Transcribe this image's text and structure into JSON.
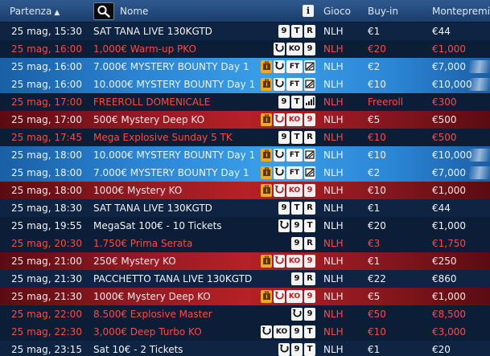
{
  "header": {
    "col_start": "Partenza",
    "sort_indicator": "▲",
    "col_name": "Nome",
    "info": "i",
    "col_game": "Gioco",
    "col_buyin": "Buy-in",
    "col_prize": "Montepremi"
  },
  "colors": {
    "header": "#2f5a8f",
    "row": "#0f2342",
    "red_text": "#ff4a3d",
    "bounty_row": "#2c86d6",
    "mystery_row": "#b52126",
    "badge_gold": "#f0a81c"
  },
  "rows": [
    {
      "time": "25 mag, 15:30",
      "name": "SAT TANA LIVE 130KGTD",
      "game": "NLH",
      "buyin": "€1",
      "prize": "€44",
      "style": "normal",
      "icons": [
        "9",
        "T",
        "R"
      ]
    },
    {
      "time": "25 mag, 16:00",
      "name": "1,000€ Warm-up PKO",
      "game": "NLH",
      "buyin": "€20",
      "prize": "€1,000",
      "style": "red-text",
      "icons": [
        "rebuy-arrow-icon",
        "KO",
        "9"
      ]
    },
    {
      "time": "25 mag, 16:00",
      "name": "7.000€ MYSTERY BOUNTY Day 1",
      "game": "NLH",
      "buyin": "€2",
      "prize": "€7,000",
      "style": "bounty",
      "icons": [
        "mystery-box-icon",
        "rebuy-arrow-icon",
        "FT",
        "multi-day-icon"
      ]
    },
    {
      "time": "25 mag, 16:00",
      "name": "10.000€ MYSTERY BOUNTY Day 1",
      "game": "NLH",
      "buyin": "€10",
      "prize": "€10,000",
      "style": "bounty",
      "icons": [
        "mystery-box-icon",
        "rebuy-arrow-icon",
        "FT",
        "multi-day-icon"
      ]
    },
    {
      "time": "25 mag, 17:00",
      "name": "FREEROLL DOMENICALE",
      "game": "NLH",
      "buyin": "Freeroll",
      "prize": "€300",
      "style": "red-text",
      "icons": [
        "9",
        "T",
        "signal-bars-icon"
      ]
    },
    {
      "time": "25 mag, 17:00",
      "name": "500€ Mystery Deep KO",
      "game": "NLH",
      "buyin": "€5",
      "prize": "€500",
      "style": "mystery",
      "icons": [
        "mystery-box-icon",
        "rebuy-arrow-icon",
        "KO",
        "9"
      ]
    },
    {
      "time": "25 mag, 17:45",
      "name": "Mega Explosive Sunday 5 TK",
      "game": "NLH",
      "buyin": "€10",
      "prize": "€500",
      "style": "red-text",
      "icons": [
        "9",
        "T",
        "R"
      ]
    },
    {
      "time": "25 mag, 18:00",
      "name": "10.000€ MYSTERY BOUNTY Day 1",
      "game": "NLH",
      "buyin": "€10",
      "prize": "€10,000",
      "style": "bounty",
      "icons": [
        "mystery-box-icon",
        "rebuy-arrow-icon",
        "FT",
        "multi-day-icon"
      ]
    },
    {
      "time": "25 mag, 18:00",
      "name": "7.000€ MYSTERY BOUNTY Day 1",
      "game": "NLH",
      "buyin": "€2",
      "prize": "€7,000",
      "style": "bounty",
      "icons": [
        "mystery-box-icon",
        "rebuy-arrow-icon",
        "FT",
        "multi-day-icon"
      ]
    },
    {
      "time": "25 mag, 18:00",
      "name": "1000€ Mystery KO",
      "game": "NLH",
      "buyin": "€10",
      "prize": "€1,000",
      "style": "mystery",
      "icons": [
        "mystery-box-icon",
        "rebuy-arrow-icon",
        "KO",
        "9"
      ]
    },
    {
      "time": "25 mag, 18:30",
      "name": "SAT TANA LIVE 130KGTD",
      "game": "NLH",
      "buyin": "€1",
      "prize": "€44",
      "style": "normal",
      "icons": [
        "9",
        "T",
        "R"
      ]
    },
    {
      "time": "25 mag, 19:55",
      "name": "MegaSat 100€ - 10 Tickets",
      "game": "NLH",
      "buyin": "€20",
      "prize": "€1,000",
      "style": "normal",
      "icons": [
        "rebuy-arrow-icon",
        "9",
        "T"
      ]
    },
    {
      "time": "25 mag, 20:30",
      "name": "1.750€ Prima Serata",
      "game": "NLH",
      "buyin": "€3",
      "prize": "€1,750",
      "style": "red-text",
      "icons": [
        "9",
        "R"
      ]
    },
    {
      "time": "25 mag, 21:00",
      "name": "250€ Mystery KO",
      "game": "NLH",
      "buyin": "€1",
      "prize": "€250",
      "style": "mystery",
      "icons": [
        "mystery-box-icon",
        "rebuy-arrow-icon",
        "KO",
        "9"
      ]
    },
    {
      "time": "25 mag, 21:30",
      "name": "PACCHETTO TANA LIVE 130KGTD",
      "game": "NLH",
      "buyin": "€22",
      "prize": "€860",
      "style": "normal",
      "icons": [
        "9",
        "R"
      ]
    },
    {
      "time": "25 mag, 21:30",
      "name": "1000€ Mystery Deep KO",
      "game": "NLH",
      "buyin": "€5",
      "prize": "€1,000",
      "style": "mystery",
      "icons": [
        "mystery-box-icon",
        "rebuy-arrow-icon",
        "KO",
        "9"
      ]
    },
    {
      "time": "25 mag, 22:00",
      "name": "8.500€ Explosive Master",
      "game": "NLH",
      "buyin": "€50",
      "prize": "€8,500",
      "style": "red-text",
      "icons": [
        "rebuy-arrow-icon",
        "9"
      ]
    },
    {
      "time": "25 mag, 22:30",
      "name": "3,000€ Deep Turbo KO",
      "game": "NLH",
      "buyin": "€10",
      "prize": "€3,000",
      "style": "red-text",
      "icons": [
        "rebuy-arrow-icon",
        "KO",
        "9",
        "T"
      ]
    },
    {
      "time": "25 mag, 23:15",
      "name": "Sat 10€ - 2 Tickets",
      "game": "NLH",
      "buyin": "€1",
      "prize": "€20",
      "style": "normal",
      "icons": [
        "rebuy-arrow-icon",
        "9",
        "T"
      ]
    }
  ]
}
